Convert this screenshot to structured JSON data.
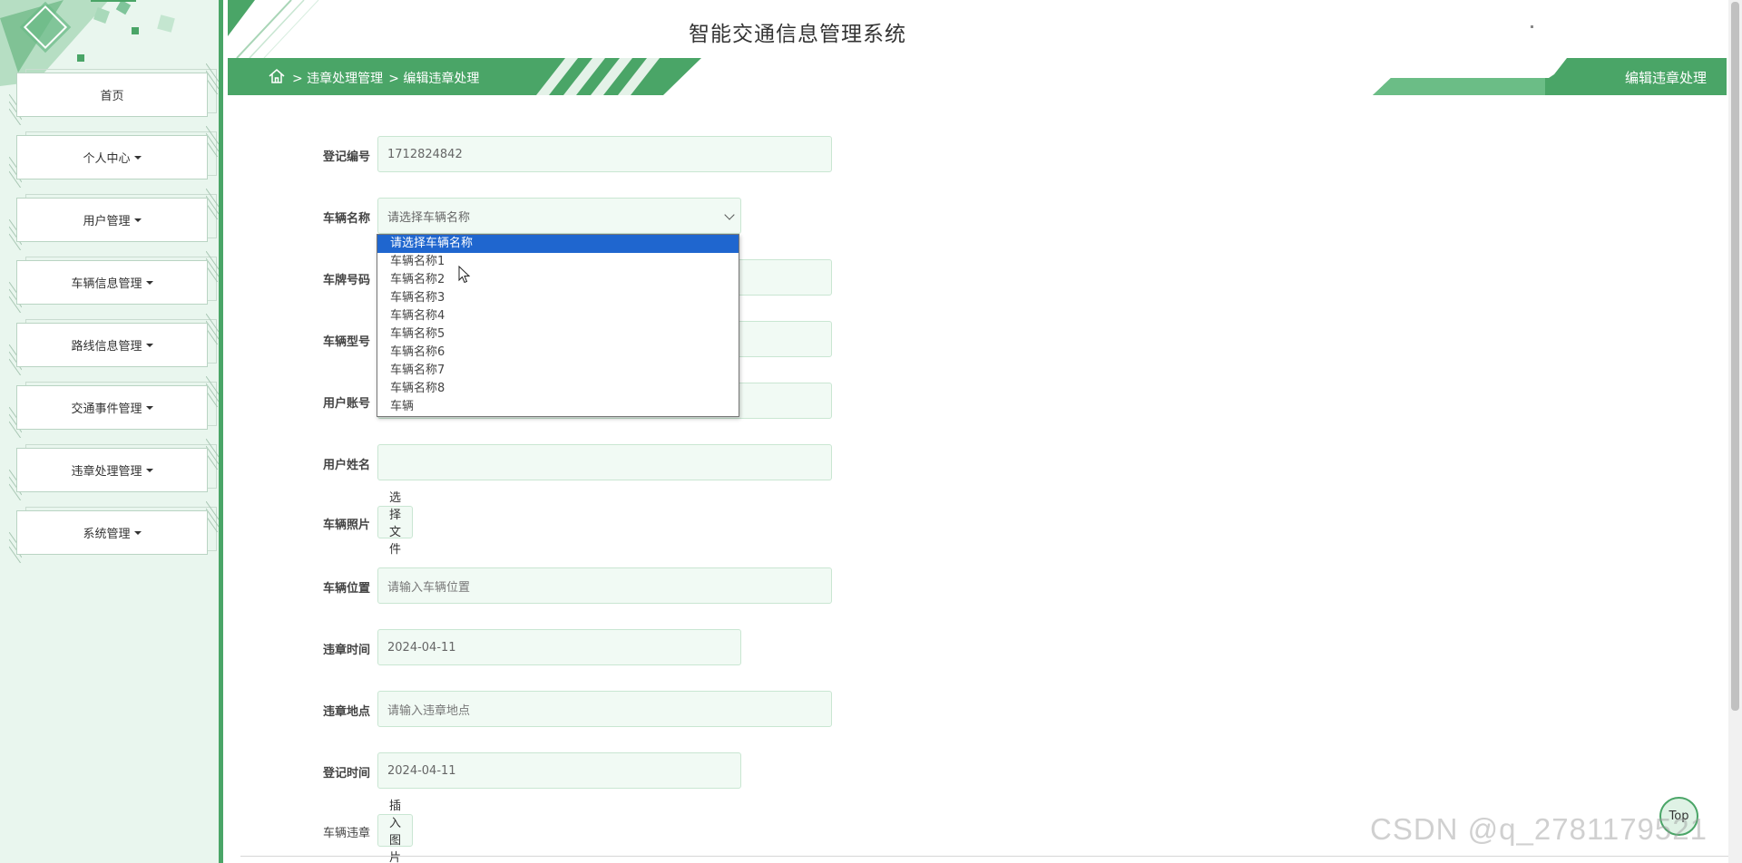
{
  "app": {
    "title": "智能交通信息管理系统"
  },
  "sidebar": {
    "items": [
      {
        "label": "首页",
        "has_caret": false
      },
      {
        "label": "个人中心",
        "has_caret": true
      },
      {
        "label": "用户管理",
        "has_caret": true
      },
      {
        "label": "车辆信息管理",
        "has_caret": true
      },
      {
        "label": "路线信息管理",
        "has_caret": true
      },
      {
        "label": "交通事件管理",
        "has_caret": true
      },
      {
        "label": "违章处理管理",
        "has_caret": true
      },
      {
        "label": "系统管理",
        "has_caret": true
      }
    ]
  },
  "breadcrumb": {
    "home_icon": "home-icon",
    "items": [
      "> 违章处理管理",
      "> 编辑违章处理"
    ],
    "page_label": "编辑违章处理"
  },
  "header": {
    "fullscreen_icon": "fullscreen-icon",
    "user_icon": "user-icon"
  },
  "form": {
    "registration_no": {
      "label": "登记编号",
      "value": "1712824842"
    },
    "vehicle_name": {
      "label": "车辆名称",
      "value": "请选择车辆名称"
    },
    "plate_no": {
      "label": "车牌号码",
      "value": ""
    },
    "vehicle_model": {
      "label": "车辆型号",
      "value": ""
    },
    "user_account": {
      "label": "用户账号",
      "value": ""
    },
    "user_name": {
      "label": "用户姓名",
      "value": ""
    },
    "vehicle_photo": {
      "label": "车辆照片",
      "button": "选择文件"
    },
    "vehicle_location": {
      "label": "车辆位置",
      "placeholder": "请输入车辆位置"
    },
    "violation_time": {
      "label": "违章时间",
      "value": "2024-04-11"
    },
    "violation_place": {
      "label": "违章地点",
      "placeholder": "请输入违章地点"
    },
    "registration_time": {
      "label": "登记时间",
      "value": "2024-04-11"
    },
    "vehicle_violation": {
      "label": "车辆违章",
      "button": "插入图片"
    }
  },
  "dropdown": {
    "options": [
      "请选择车辆名称",
      "车辆名称1",
      "车辆名称2",
      "车辆名称3",
      "车辆名称4",
      "车辆名称5",
      "车辆名称6",
      "车辆名称7",
      "车辆名称8",
      "车辆"
    ],
    "selected_index": 0
  },
  "top_button": {
    "label": "Top"
  },
  "watermark": {
    "text": "CSDN @q_2781179521"
  },
  "colors": {
    "accent": "#4aa567",
    "sidebar_bg": "#e9f6ee",
    "input_bg": "#f1faf4",
    "dropdown_highlight": "#1f66cf",
    "user_btn": "#2f5e7c"
  }
}
